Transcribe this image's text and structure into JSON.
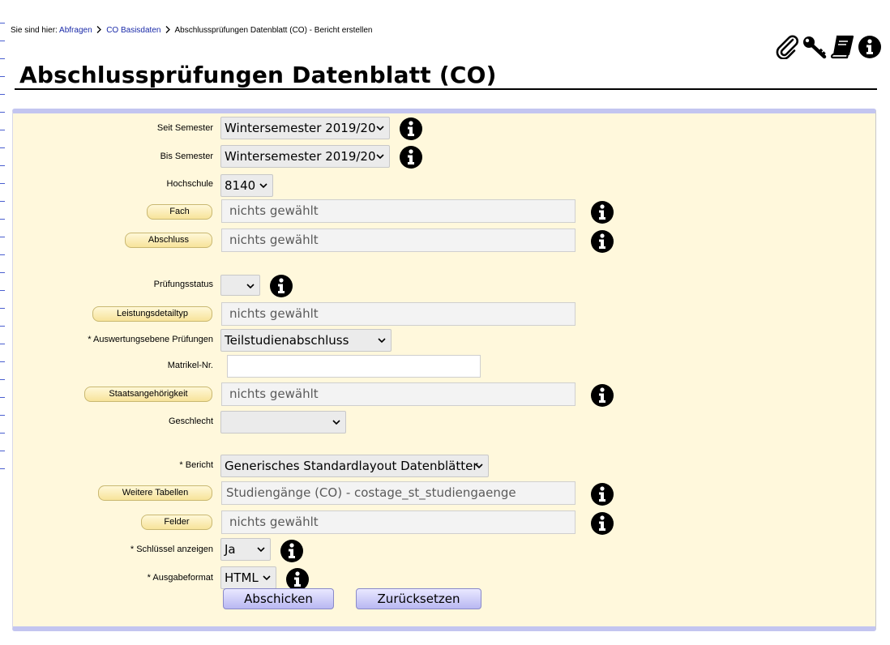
{
  "breadcrumb": {
    "prefix": "Sie sind hier:",
    "items": [
      "Abfragen",
      "CO Basisdaten"
    ],
    "current": "Abschlussprüfungen Datenblatt (CO) - Bericht erstellen"
  },
  "toolbar": {
    "icons": [
      "paperclip-icon",
      "key-icon",
      "book-icon",
      "info-icon"
    ]
  },
  "page": {
    "title": "Abschlussprüfungen Datenblatt (CO)"
  },
  "form": {
    "seit_semester": {
      "label": "Seit Semester",
      "value": "Wintersemester 2019/20"
    },
    "bis_semester": {
      "label": "Bis Semester",
      "value": "Wintersemester 2019/20"
    },
    "hochschule": {
      "label": "Hochschule",
      "value": "8140"
    },
    "fach": {
      "button": "Fach",
      "value": "nichts gewählt"
    },
    "abschluss": {
      "button": "Abschluss",
      "value": "nichts gewählt"
    },
    "pruefungsstatus": {
      "label": "Prüfungsstatus",
      "value": ""
    },
    "leistungsdetailtyp": {
      "button": "Leistungsdetailtyp",
      "value": "nichts gewählt"
    },
    "auswertungsebene": {
      "label": "* Auswertungsebene Prüfungen",
      "value": "Teilstudienabschluss"
    },
    "matrikel": {
      "label": "Matrikel-Nr.",
      "value": ""
    },
    "staatsangehoerigkeit": {
      "button": "Staatsangehörigkeit",
      "value": "nichts gewählt"
    },
    "geschlecht": {
      "label": "Geschlecht",
      "value": ""
    },
    "bericht": {
      "label": "* Bericht",
      "value": "Generisches Standardlayout Datenblätter"
    },
    "weitere_tabellen": {
      "button": "Weitere Tabellen",
      "value": "Studiengänge (CO) - costage_st_studiengaenge"
    },
    "felder": {
      "button": "Felder",
      "value": "nichts gewählt"
    },
    "schluessel": {
      "label": "* Schlüssel anzeigen",
      "value": "Ja"
    },
    "ausgabeformat": {
      "label": "* Ausgabeformat",
      "value": "HTML"
    }
  },
  "actions": {
    "submit": "Abschicken",
    "reset": "Zurücksetzen"
  },
  "colors": {
    "panel_bg": "#fff8dc",
    "panel_border": "#c3c5f0",
    "link": "#1a2aa8"
  }
}
